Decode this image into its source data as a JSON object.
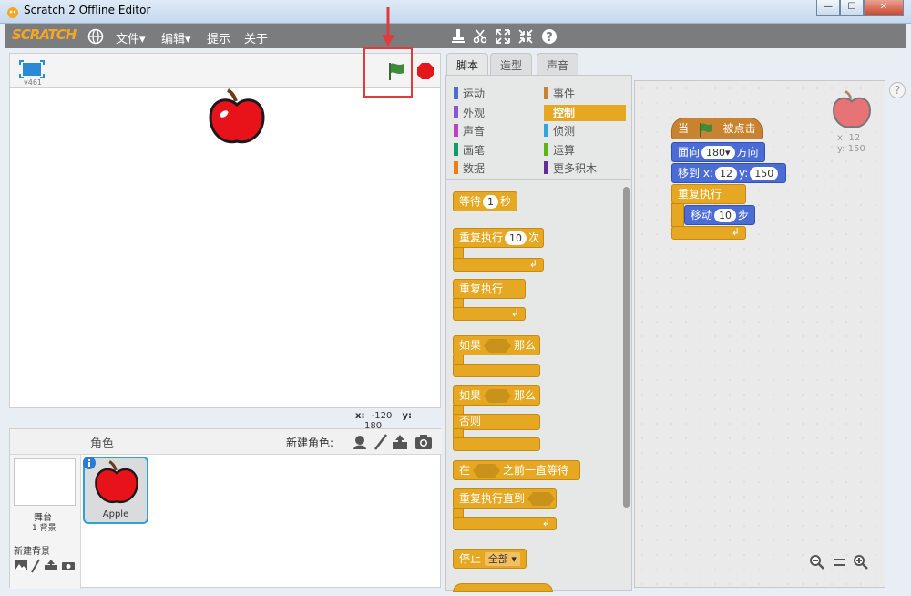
{
  "window": {
    "title": "Scratch 2 Offline Editor",
    "minimize": "—",
    "maximize": "☐",
    "close": "✕"
  },
  "menu": {
    "logo": "SCRATCH",
    "file": "文件▾",
    "edit": "编辑▾",
    "tips": "提示",
    "about": "关于"
  },
  "stage": {
    "version": "v461",
    "coords_x_label": "x:",
    "coords_x": "-120",
    "coords_y_label": "y:",
    "coords_y": "180"
  },
  "sprites": {
    "header": "角色",
    "new_sprite_label": "新建角色:",
    "stage_label": "舞台",
    "backdrop_count": "1 背景",
    "new_backdrop": "新建背景",
    "sprite_name": "Apple"
  },
  "tabs": [
    "脚本",
    "造型",
    "声音"
  ],
  "categories": [
    {
      "label": "运动",
      "color": "#4a6cd4"
    },
    {
      "label": "事件",
      "color": "#c88330"
    },
    {
      "label": "外观",
      "color": "#8a55d7"
    },
    {
      "label": "控制",
      "color": "#e6a822"
    },
    {
      "label": "声音",
      "color": "#bb42c3"
    },
    {
      "label": "侦测",
      "color": "#2ca5e2"
    },
    {
      "label": "画笔",
      "color": "#0e9a6c"
    },
    {
      "label": "运算",
      "color": "#5cb712"
    },
    {
      "label": "数据",
      "color": "#ee7d16"
    },
    {
      "label": "更多积木",
      "color": "#632d99"
    }
  ],
  "palette": {
    "wait": "等待",
    "wait_num": "1",
    "wait_unit": "秒",
    "repeat": "重复执行",
    "repeat_num": "10",
    "repeat_unit": "次",
    "forever": "重复执行",
    "if": "如果",
    "then": "那么",
    "if2": "如果",
    "then2": "那么",
    "else": "否则",
    "wait_until_pre": "在",
    "wait_until_post": "之前一直等待",
    "repeat_until": "重复执行直到",
    "stop": "停止",
    "stop_opt": "全部"
  },
  "script": {
    "when": "当",
    "clicked": "被点击",
    "point_pre": "面向",
    "point_val": "180",
    "point_post": "方向",
    "goto": "移到 x:",
    "goto_x": "12",
    "goto_y_label": "y:",
    "goto_y": "150",
    "forever": "重复执行",
    "move": "移动",
    "move_val": "10",
    "move_unit": "步"
  },
  "sprite_info": {
    "x": "x: 12",
    "y": "y: 150"
  },
  "help": "?"
}
